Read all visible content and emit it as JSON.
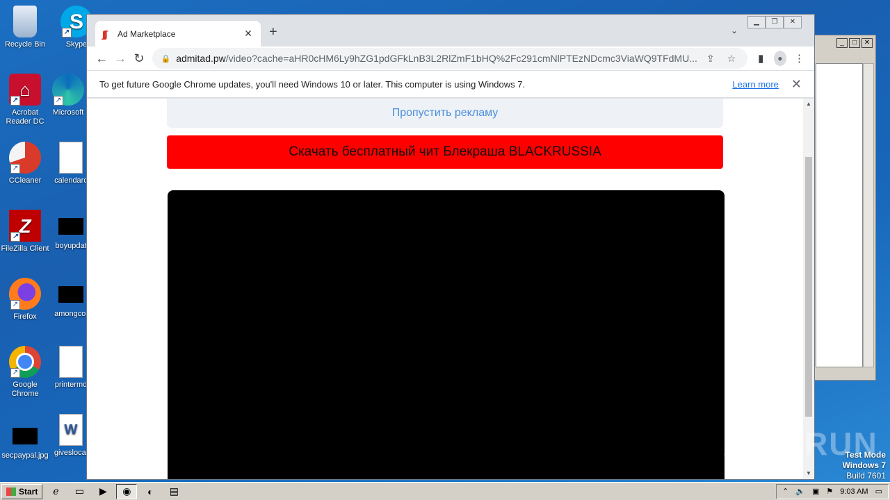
{
  "desktop": {
    "icons_col1": [
      {
        "label": "Recycle Bin"
      },
      {
        "label": "Acrobat Reader DC"
      },
      {
        "label": "CCleaner"
      },
      {
        "label": "FileZilla Client"
      },
      {
        "label": "Firefox"
      },
      {
        "label": "Google Chrome"
      },
      {
        "label": "secpaypal.jpg"
      }
    ],
    "icons_col2": [
      {
        "label": "Skype"
      },
      {
        "label": "Microsoft"
      },
      {
        "label": "calendarc"
      },
      {
        "label": "boyupdat"
      },
      {
        "label": "amongcoi"
      },
      {
        "label": "printermo"
      },
      {
        "label": "giveslocal"
      }
    ]
  },
  "browser": {
    "tab": {
      "title": "Ad Marketplace"
    },
    "address": {
      "domain": "admitad.pw",
      "path": "/video?cache=aHR0cHM6Ly9hZG1pdGFkLnB3L2RlZmF1bHQ%2Fc291cmNlPTEzNDcmc3ViaWQ9TFdMU..."
    },
    "infobar": {
      "message": "To get future Google Chrome updates, you'll need Windows 10 or later. This computer is using Windows 7.",
      "link": "Learn more"
    },
    "page": {
      "skip_label": "Пропустить рекламу",
      "cheat_label": "Скачать бесплатный чит Блекраша BLACKRUSSIA"
    }
  },
  "watermark": {
    "text": "ANY RUN"
  },
  "system": {
    "test_mode": "Test Mode",
    "os": "Windows 7",
    "build": "Build 7601",
    "start_label": "Start",
    "clock": "9:03 AM"
  },
  "colors": {
    "cheat_button": "#ff0000",
    "skip_text": "#4a8fdc",
    "desktop": "#1a5fb0"
  }
}
